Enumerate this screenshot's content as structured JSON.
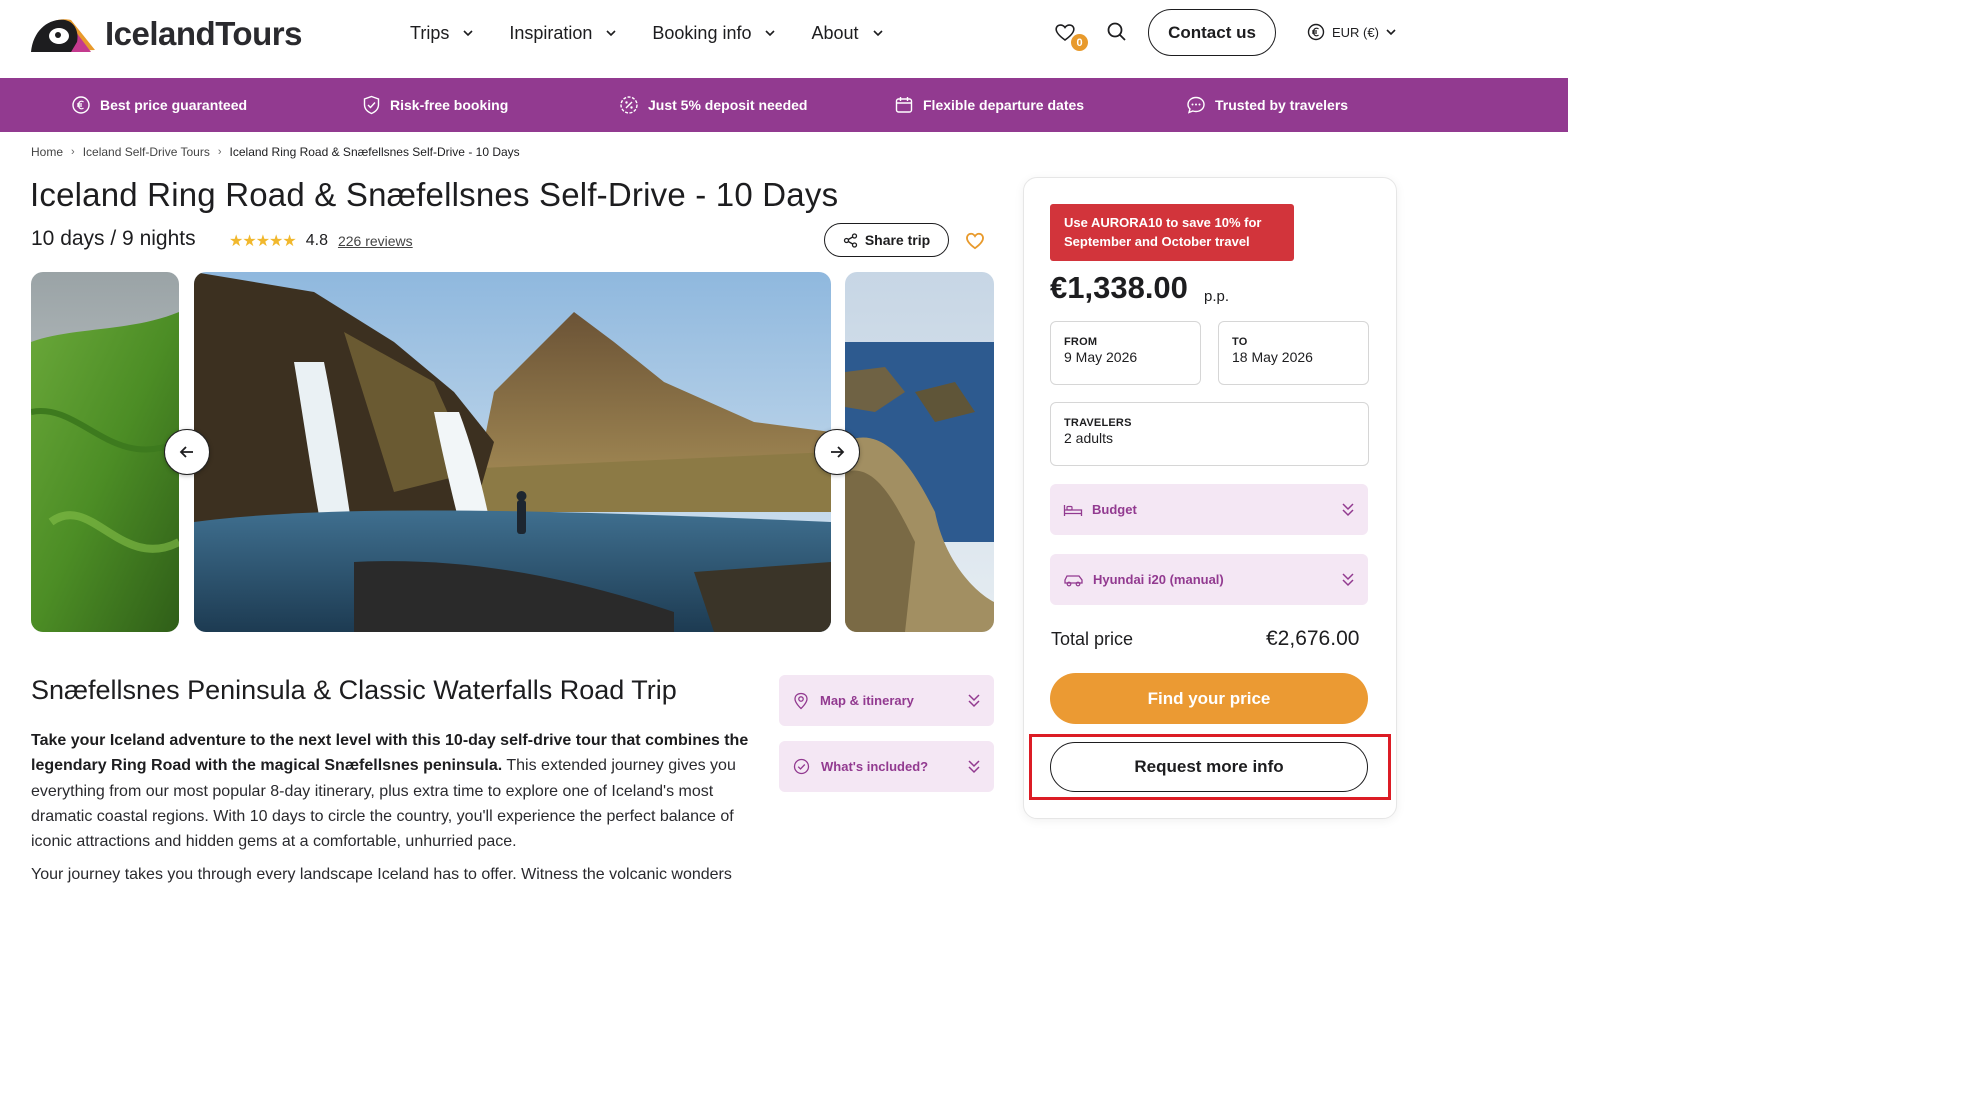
{
  "header": {
    "logo_text": "IcelandTours",
    "nav": [
      {
        "label": "Trips"
      },
      {
        "label": "Inspiration"
      },
      {
        "label": "Booking info"
      },
      {
        "label": "About"
      }
    ],
    "wishlist_count": "0",
    "contact_label": "Contact us",
    "currency_label": "EUR (€)"
  },
  "usp_bar": {
    "items": [
      {
        "label": "Best price guaranteed",
        "icon": "euro-circle-icon"
      },
      {
        "label": "Risk-free booking",
        "icon": "shield-check-icon"
      },
      {
        "label": "Just 5% deposit needed",
        "icon": "percent-badge-icon"
      },
      {
        "label": "Flexible departure dates",
        "icon": "calendar-icon"
      },
      {
        "label": "Trusted by travelers",
        "icon": "chat-bubble-icon"
      }
    ],
    "color": "#923a90"
  },
  "breadcrumb": [
    "Home",
    "Iceland Self-Drive Tours",
    "Iceland Ring Road & Snæfellsnes Self-Drive - 10 Days"
  ],
  "tour": {
    "title": "Iceland Ring Road & Snæfellsnes Self-Drive - 10 Days",
    "duration": "10 days / 9 nights",
    "stars": "★★★★★",
    "rating": "4.8",
    "reviews": "226 reviews",
    "share_label": "Share trip"
  },
  "content": {
    "subtitle": "Snæfellsnes Peninsula & Classic Waterfalls Road Trip",
    "desc_bold": "Take your Iceland adventure to the next level with this 10-day self-drive tour that combines the legendary Ring Road with the magical Snæfellsnes peninsula.",
    "desc_rest": " This extended journey gives you everything from our most popular 8-day itinerary, plus extra time to explore one of Iceland's most dramatic coastal regions. With 10 days to circle the country, you'll experience the perfect balance of iconic attractions and hidden gems at a comfortable, unhurried pace.",
    "desc2": "Your journey takes you through every landscape Iceland has to offer. Witness the volcanic wonders",
    "accordion": [
      {
        "label": "Map & itinerary",
        "icon": "map-pin-icon"
      },
      {
        "label": "What's included?",
        "icon": "check-circle-icon"
      }
    ]
  },
  "booking": {
    "promo": "Use AURORA10 to save 10% for September and October travel",
    "price": "€1,338.00",
    "price_unit": "p.p.",
    "from_label": "FROM",
    "from_value": "9 May 2026",
    "to_label": "TO",
    "to_value": "18 May 2026",
    "travelers_label": "TRAVELERS",
    "travelers_value": "2 adults",
    "accommodation": "Budget",
    "car": "Hyundai i20 (manual)",
    "total_label": "Total price",
    "total_value": "€2,676.00",
    "find_price_label": "Find your price",
    "request_info_label": "Request more info",
    "accent": "#eb9a33",
    "promo_color": "#d2343b"
  }
}
